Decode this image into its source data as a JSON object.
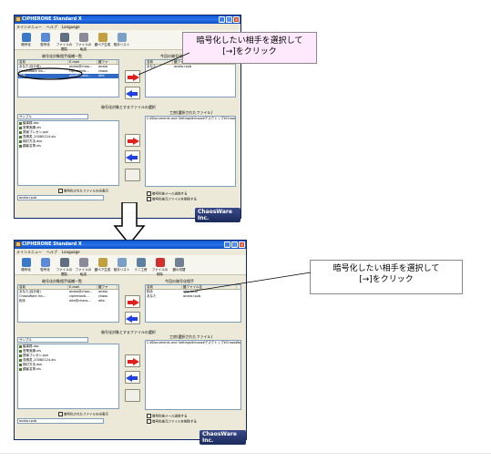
{
  "window": {
    "title": "CIPHERONE Standard X",
    "menu": [
      "メインメニュー",
      "ヘルプ",
      "Language"
    ]
  },
  "toolbar": [
    "暗号化",
    "復号化",
    "ファイルの閲覧",
    "ファイルの転送",
    "鍵ペア生成",
    "相手リスト",
    "ミニ工房",
    "ファイルの削除",
    "鍵の切替"
  ],
  "left_panel": {
    "title": "暗号化対象相手候補一覧",
    "columns": [
      "名前",
      "E-mail",
      "鍵ファ"
    ],
    "rows_top": [
      [
        "あなた(自分用)",
        "anata@chao...",
        "anata"
      ],
      [
        "ChaosWare Ins...",
        "cipheronib...",
        "chaos"
      ],
      [
        "相手",
        "aite@chaos...",
        "aite"
      ]
    ],
    "rows_bottom": [
      [
        "あなた(自分用)",
        "anata@chao...",
        "anata"
      ],
      [
        "ChaosWare Ins...",
        "cipheronib...",
        "chaos"
      ],
      [
        "相手",
        "aite@chaos...",
        "aite."
      ]
    ]
  },
  "right_panel": {
    "title": "今回の暗号化相手",
    "columns": [
      "名前",
      "鍵ファイル名"
    ],
    "rows_top": [
      [
        "あなた",
        "anata.rpub"
      ]
    ],
    "rows_bottom": [
      [
        "相手",
        "aite.rpub"
      ],
      [
        "あなた",
        "anata.rpub"
      ]
    ]
  },
  "files": {
    "section_title": "暗号化対象とするファイルの選択",
    "folder": "サンプル",
    "items": [
      "議事録.doc",
      "営業実績.xls",
      "提案プレゼン.ppt",
      "見積書_20080124.xls",
      "検討方法.doc",
      "顧客名簿.xls"
    ],
    "selected_title": "工房(選択されたファイル)",
    "selected_path": "C:¥Documents and Settings¥chaos¥デスクトップ¥ChaosWare...",
    "show_encrypted": "暗号化されたファイルのみ表示",
    "keyfile": "anata.rpub",
    "opt_mail": "暗号化後メール送信する",
    "opt_delete": "暗号化後元ファイルを削除する"
  },
  "logo": "ChaosWare Inc.",
  "callout_top": {
    "line1": "暗号化したい相手を選択して",
    "line2": "[→]をクリック"
  },
  "callout_bottom": {
    "line1": "暗号化したい相手を選択して",
    "line2": "[→]をクリック"
  }
}
